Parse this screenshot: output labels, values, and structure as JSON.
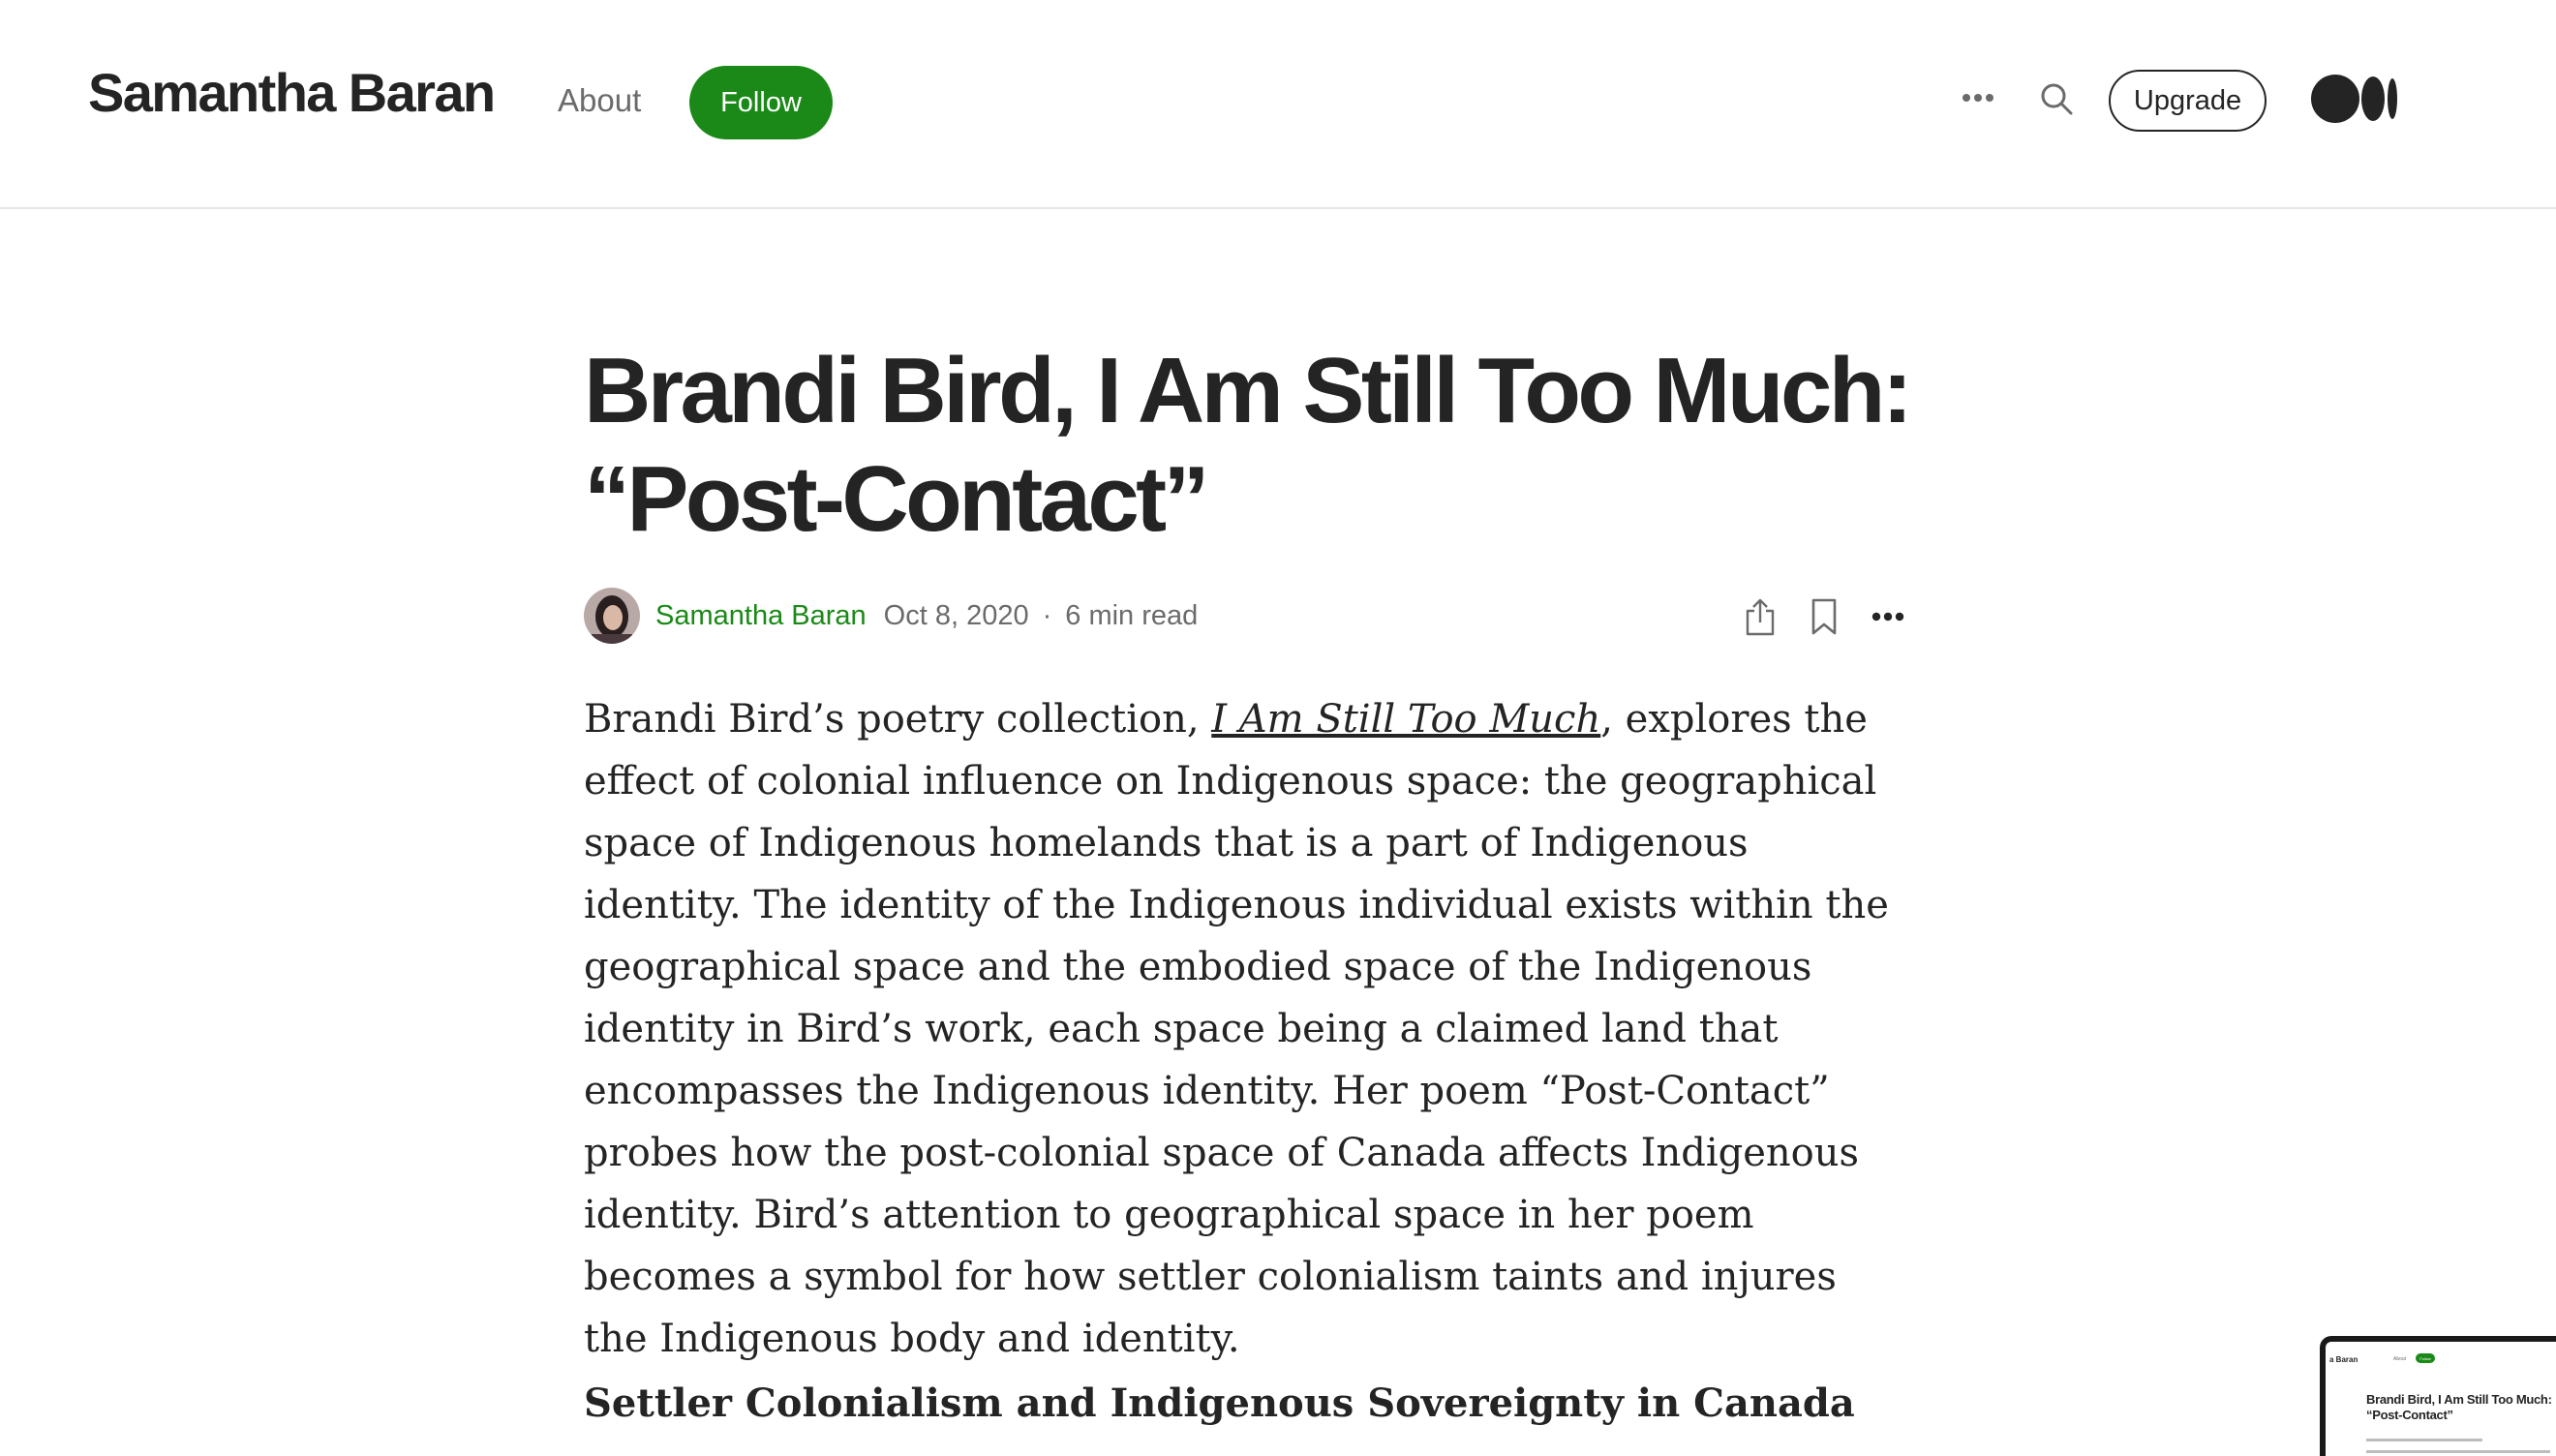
{
  "header": {
    "brand": "Samantha Baran",
    "nav_about": "About",
    "follow_label": "Follow",
    "upgrade_label": "Upgrade",
    "icons": [
      "more-horizontal-icon",
      "search-icon",
      "medium-logo-icon"
    ]
  },
  "article": {
    "title_line1": "Brandi Bird, I Am Still Too Much:",
    "title_line2": "“Post-Contact”",
    "author": "Samantha Baran",
    "date": "Oct 8, 2020",
    "separator": "·",
    "read_time": "6 min read",
    "actions": [
      "share-icon",
      "bookmark-icon",
      "more-options-icon"
    ],
    "p1_before": "Brandi Bird’s poetry collection, ",
    "p1_link": "I Am Still Too Much",
    "p1_after": ", explores the effect of colonial influence on Indigenous space: the geographical space of Indigenous homelands that is a part of Indigenous identity. The identity of the Indigenous individual exists within the geographical space and the embodied space of the Indigenous identity in Bird’s work, each space being a claimed land that encompasses the Indigenous identity. Her poem “Post-Contact” probes how the post-colonial space of Canada affects Indigenous identity. Bird’s attention to geographical space in her poem becomes a symbol for how settler colonialism taints and injures the Indigenous body and identity.",
    "subheading": "Settler Colonialism and Indigenous Sovereignty in Canada"
  },
  "thumbnail": {
    "brand": "a Baran",
    "nav": "About",
    "follow": "Follow",
    "title": "Brandi Bird, I Am Still Too Much: “Post-Contact”"
  },
  "colors": {
    "accent_green": "#1a8917",
    "text": "#242424",
    "muted": "#6b6b6b",
    "divider": "#e6e6e6"
  }
}
